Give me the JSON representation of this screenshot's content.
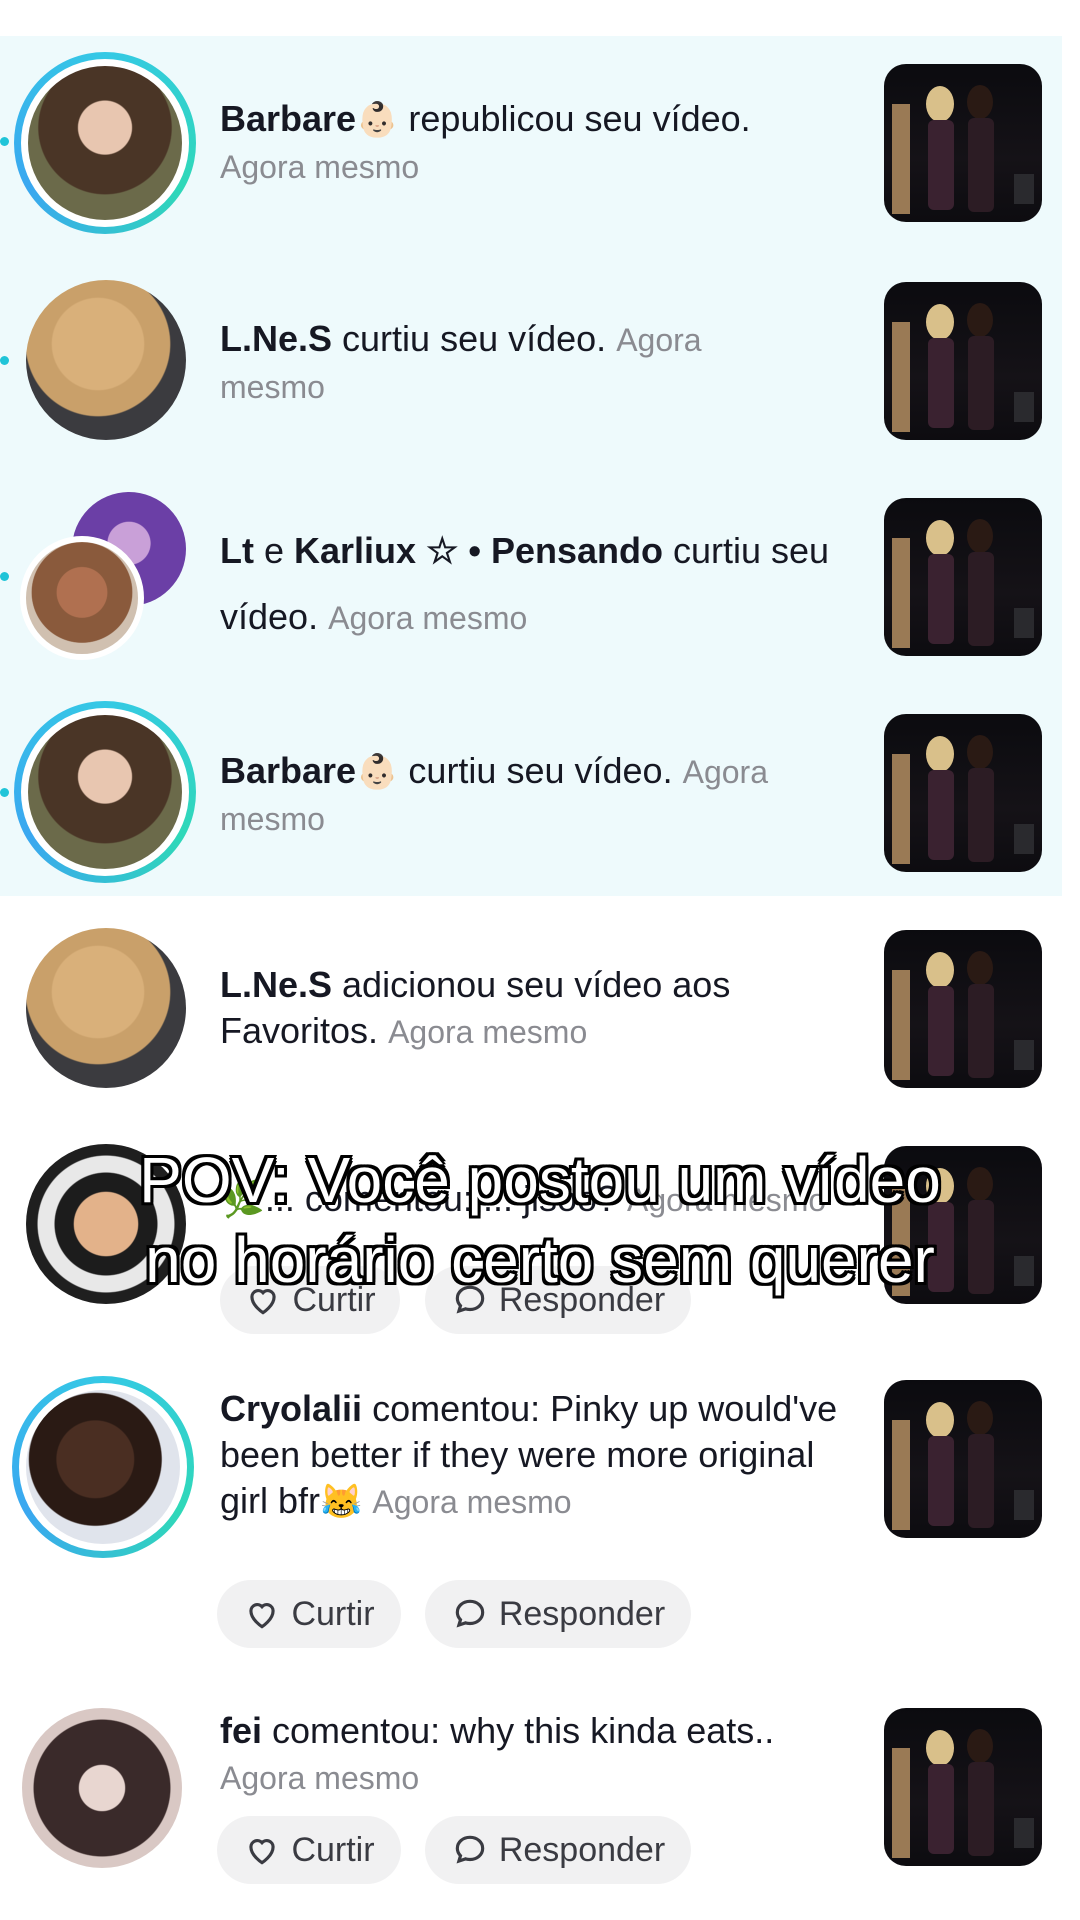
{
  "notifications": [
    {
      "user": "Barbare",
      "badge": "👶🏻",
      "action": " republicou seu vídeo.",
      "time": "Agora mesmo"
    },
    {
      "user": "L.Ne.S",
      "action": " curtiu seu vídeo.",
      "time": "Agora mesmo"
    },
    {
      "user": "Lt",
      "conj": " e ",
      "user2": "Karliux ☆ • Pensando",
      "action": " curtiu seu vídeo.",
      "time": "Agora mesmo"
    },
    {
      "user": "Barbare",
      "badge": "👶🏻",
      "action": " curtiu seu vídeo.",
      "time": "Agora mesmo"
    },
    {
      "user": "L.Ne.S",
      "action": " adicionou seu vídeo aos Favoritos.",
      "time": "Agora mesmo"
    },
    {
      "user": "🌿",
      "action": "... comentou: ... jisoo?",
      "time": "Agora mesmo",
      "like_label": "Curtir",
      "reply_label": "Responder"
    },
    {
      "user": "Cryolalii",
      "action": " comentou: Pinky up would've been better if they were more original girl bfr",
      "emoji": "😹",
      "time": "Agora mesmo",
      "like_label": "Curtir",
      "reply_label": "Responder"
    },
    {
      "user": "fei",
      "action": " comentou: why this kinda eats..",
      "time": "Agora mesmo",
      "like_label": "Curtir",
      "reply_label": "Responder"
    }
  ],
  "overlay": {
    "line1": "POV: Você postou um vídeo",
    "line2": "no horário certo sem querer"
  },
  "colors": {
    "highlight_bg": "#eefafc",
    "ring": "#35c9e5",
    "unread_dot": "#20c4d8"
  },
  "icons": [
    "heart-icon",
    "comment-bubble-icon"
  ]
}
